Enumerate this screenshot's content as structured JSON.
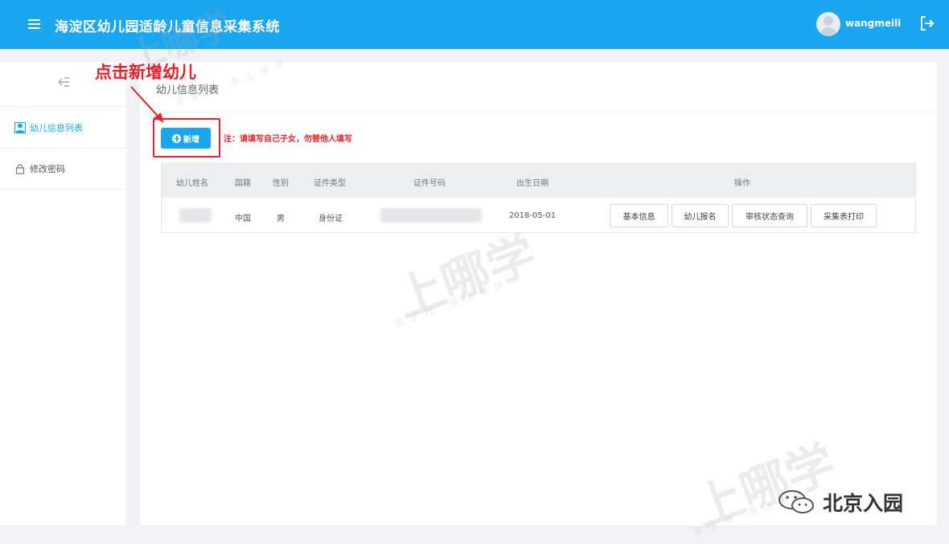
{
  "header": {
    "menu_icon": "hamburger-icon",
    "title": "海淀区幼儿园适龄儿童信息采集系统",
    "username": "wangmeili",
    "avatar_icon": "user-avatar",
    "logout_icon": "logout-icon",
    "bg_color": "#1aa7f0"
  },
  "sidebar": {
    "collapse_icon": "arrow-collapse-icon",
    "items": [
      {
        "label": "幼儿信息列表",
        "icon": "child-icon",
        "active": true
      },
      {
        "label": "修改密码",
        "icon": "lock-icon",
        "active": false
      }
    ]
  },
  "main": {
    "page_title": "幼儿信息列表",
    "add_button_label": "新增",
    "notice": "注：请填写自己子女，勿替他人填写",
    "table": {
      "headers": [
        "幼儿姓名",
        "国籍",
        "性别",
        "证件类型",
        "证件号码",
        "出生日期",
        "操作"
      ],
      "rows": [
        {
          "name": "",
          "nationality": "中国",
          "gender": "男",
          "id_type": "身份证",
          "id_number": "",
          "birth_date": "2018-05-01",
          "actions": [
            "基本信息",
            "幼儿报名",
            "审核状态查询",
            "采集表打印"
          ]
        }
      ]
    }
  },
  "annotation": {
    "text": "点击新增幼儿",
    "color": "#e8202a"
  },
  "watermark": {
    "text": "上哪学",
    "subtext": "家学校 用上哪学"
  },
  "badge": {
    "text": "北京入园",
    "icon": "wechat-icon"
  }
}
